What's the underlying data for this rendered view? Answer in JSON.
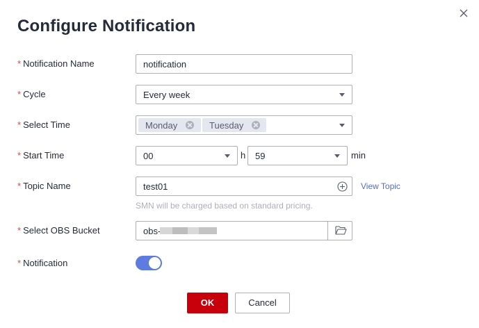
{
  "dialog": {
    "title": "Configure Notification",
    "close_icon": "close-icon"
  },
  "form": {
    "notification_name": {
      "label": "Notification Name",
      "required_mark": "*",
      "value": "notification"
    },
    "cycle": {
      "label": "Cycle",
      "required_mark": "*",
      "value": "Every week"
    },
    "select_time": {
      "label": "Select Time",
      "required_mark": "*",
      "chips": [
        "Monday",
        "Tuesday"
      ]
    },
    "start_time": {
      "label": "Start Time",
      "required_mark": "*",
      "hour": "00",
      "hour_unit": "h",
      "minute": "59",
      "minute_unit": "min"
    },
    "topic_name": {
      "label": "Topic Name",
      "required_mark": "*",
      "value": "test01",
      "view_link": "View Topic",
      "hint": "SMN will be charged based on standard pricing."
    },
    "obs_bucket": {
      "label": "Select OBS Bucket",
      "required_mark": "*",
      "value_prefix": "obs-"
    },
    "notification": {
      "label": "Notification",
      "required_mark": "*",
      "enabled": true
    }
  },
  "footer": {
    "ok_label": "OK",
    "cancel_label": "Cancel"
  },
  "colors": {
    "primary_button": "#c7000b",
    "toggle_on": "#5e7ce0",
    "link": "#526ecc",
    "required": "#e54545"
  }
}
